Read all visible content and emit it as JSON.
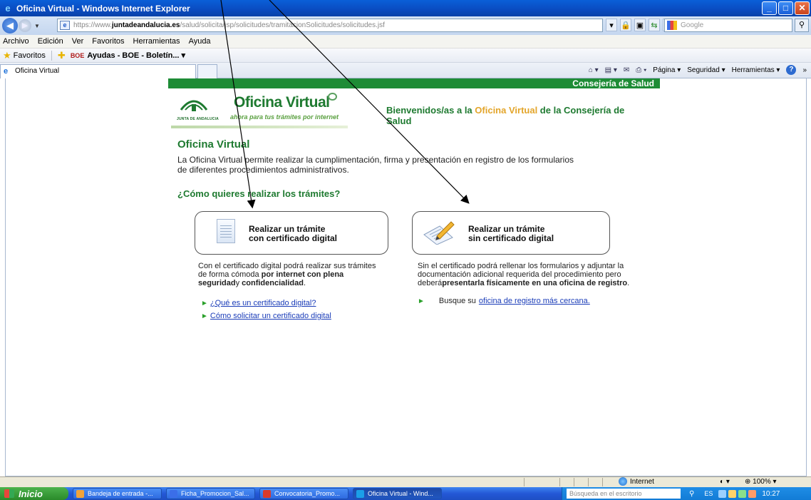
{
  "window": {
    "title": "Oficina Virtual - Windows Internet Explorer",
    "minimize": "_",
    "maximize": "□",
    "close": "✕"
  },
  "address": {
    "url_prefix": "https://www.",
    "url_domain": "juntadeandalucia.es",
    "url_rest": "/salud/solicita/jsp/solicitudes/tramitacionSolicitudes/solicitudes.jsf",
    "search_placeholder": "Google"
  },
  "menu": [
    "Archivo",
    "Edición",
    "Ver",
    "Favoritos",
    "Herramientas",
    "Ayuda"
  ],
  "favorites": {
    "label": "Favoritos",
    "item_prefix": "BOE",
    "item": "Ayudas - BOE - Boletín... ▾"
  },
  "tab": {
    "label": "Oficina Virtual"
  },
  "commandbar": {
    "page": "Página ▾",
    "security": "Seguridad ▾",
    "tools": "Herramientas ▾",
    "more": "»"
  },
  "page": {
    "consejeria": "Consejería de Salud",
    "logo_title": "Oficina Virtual",
    "logo_sub": "ahora para tus trámites por internet",
    "logo_junta": "JUNTA DE ANDALUCIA",
    "welcome_pre": "Bienvenidos/as a la ",
    "welcome_hl": "Oficina Virtual",
    "welcome_post": " de la Consejería de Salud",
    "heading": "Oficina Virtual",
    "intro": "La Oficina Virtual permite realizar la cumplimentación, firma y presentación en registro de los formularios de diferentes procedimientos administrativos.",
    "question": "¿Cómo quieres realizar los trámites?",
    "option1": {
      "line1": "Realizar un trámite",
      "line2": "con certificado digital"
    },
    "option2": {
      "line1": "Realizar un trámite",
      "line2": "sin certificado digital"
    },
    "desc1": {
      "a": "Con el certificado digital podrá realizar sus trámites de forma cómoda ",
      "b": "por internet con plena seguridad",
      "c": "y ",
      "d": "confidencialidad",
      "e": "."
    },
    "desc2": {
      "a": "Sin el certificado podrá rellenar los formularios y adjuntar la documentación adicional requerida del procedimiento pero deberá",
      "b": "presentarla físicamente en una oficina de registro",
      "c": "."
    },
    "link1": "¿Qué es un certificado digital?",
    "link2": "Cómo solicitar un certificado digital",
    "link3_pre": "Busque su",
    "link3": "oficina de registro más cercana."
  },
  "status": {
    "zone": "Internet",
    "zoom": "100%"
  },
  "taskbar": {
    "start": "Inicio",
    "items": [
      {
        "label": "Bandeja de entrada -...",
        "color": "#f2a33a"
      },
      {
        "label": "Ficha_Promocion_Sal...",
        "color": "#3b6ee8"
      },
      {
        "label": "Convocatoria_Promo...",
        "color": "#d93a2b"
      },
      {
        "label": "Oficina Virtual - Wind...",
        "color": "#1b9fe8"
      }
    ],
    "desk_search": "Búsqueda en el escritorio",
    "lang": "ES",
    "clock": "10:27"
  }
}
